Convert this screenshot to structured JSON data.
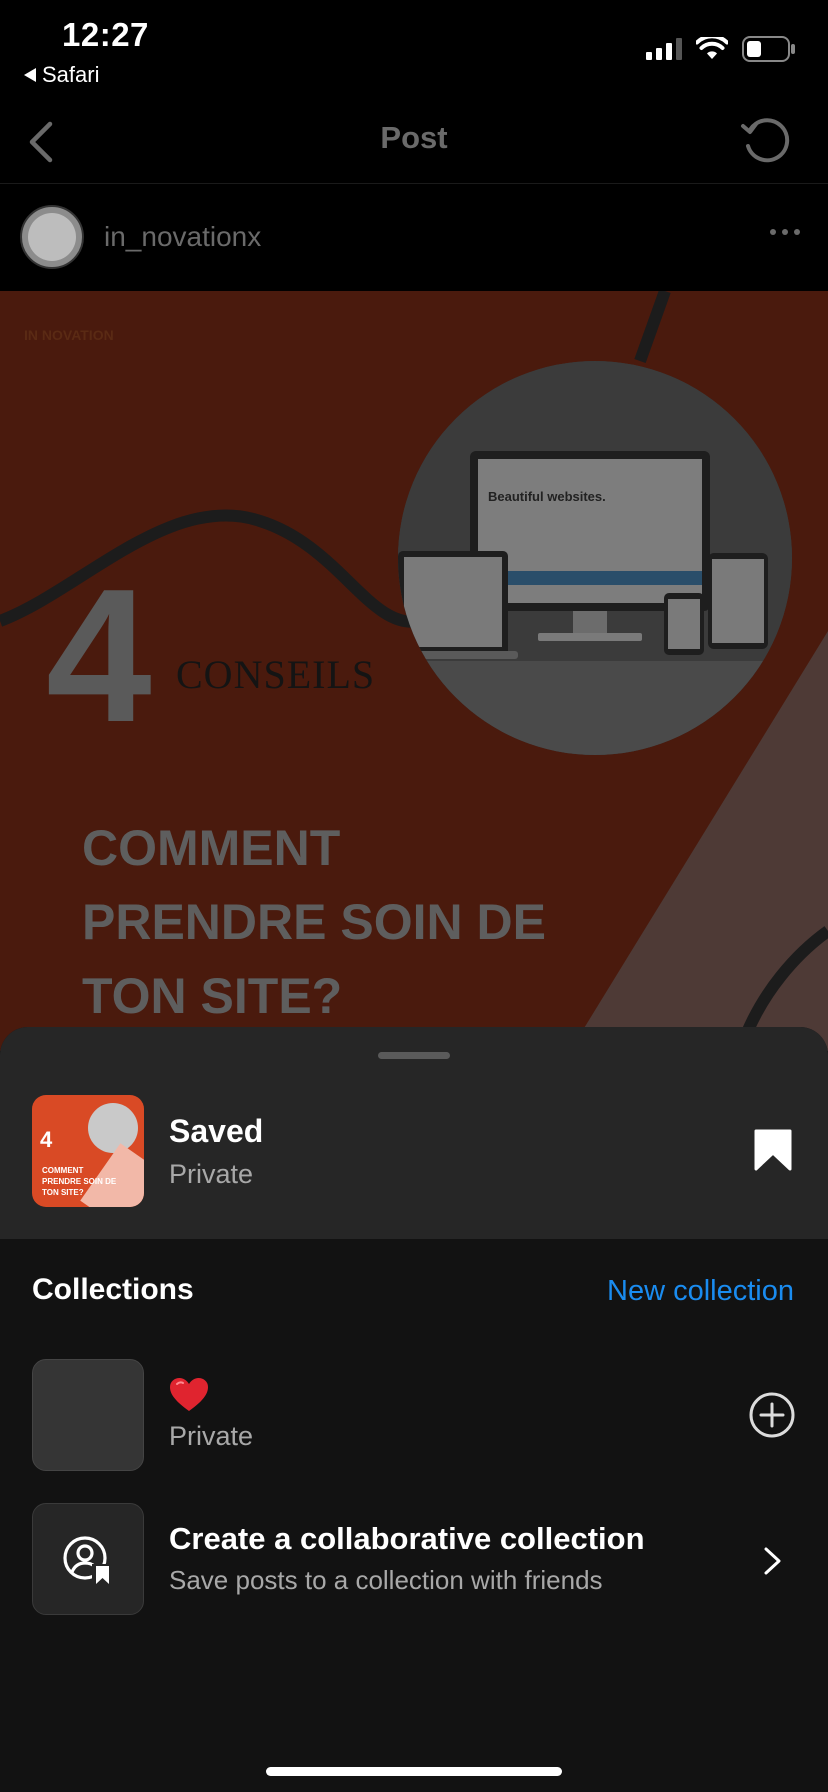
{
  "status_bar": {
    "time": "12:27",
    "back_app": "Safari"
  },
  "nav": {
    "title": "Post",
    "back_icon": "chevron-left-icon",
    "refresh_icon": "refresh-icon"
  },
  "post": {
    "username": "in_novationx",
    "image": {
      "brand": "IN NOVATION",
      "number": "4",
      "conseils": "CONSEILS",
      "headline_lines": [
        "COMMENT",
        "PRENDRE SOIN DE",
        "TON SITE?"
      ],
      "photo_caption": "Beautiful websites."
    }
  },
  "sheet": {
    "saved": {
      "name": "Saved",
      "privacy": "Private",
      "thumb_number": "4",
      "thumb_text": "COMMENT PRENDRE SOIN DE TON SITE?"
    },
    "collections_label": "Collections",
    "new_collection": "New collection",
    "collections": [
      {
        "name": "❤️",
        "privacy": "Private"
      }
    ],
    "collaborative": {
      "title": "Create a collaborative collection",
      "subtitle": "Save posts to a collection with friends"
    }
  },
  "colors": {
    "accent": "#1a8cf0",
    "post_bg": "#4a1a0d",
    "sheet_bg": "#121212",
    "sheet_top_bg": "#262626"
  }
}
